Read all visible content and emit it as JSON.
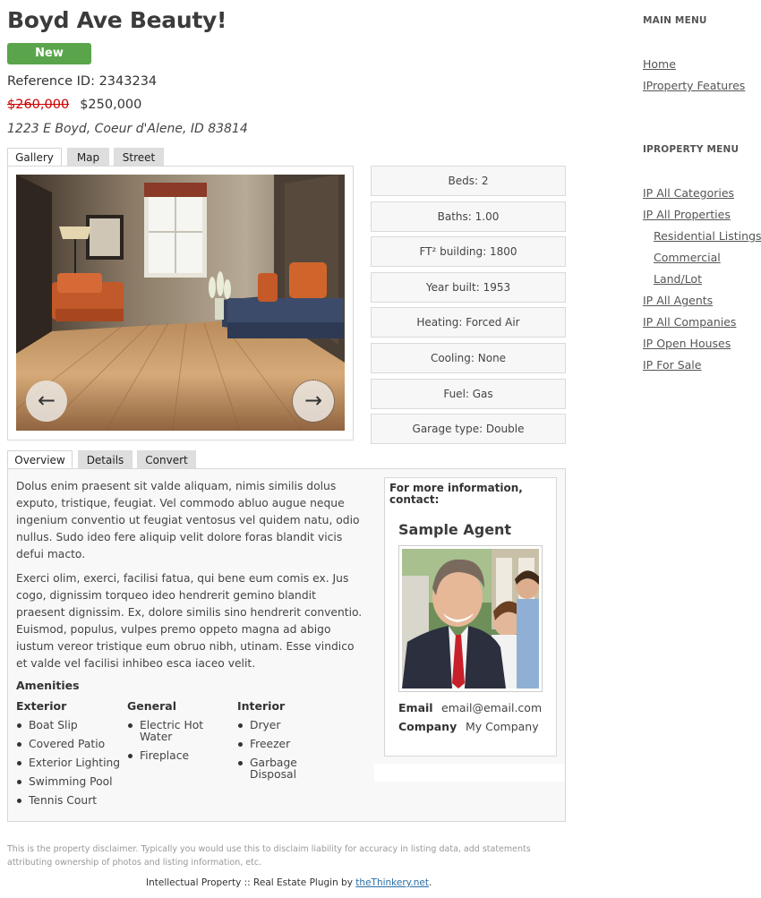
{
  "listing": {
    "title": "Boyd Ave Beauty!",
    "badge": "New",
    "reference_label": "Reference ID:",
    "reference_id": "2343234",
    "old_price": "$260,000",
    "price": "$250,000",
    "address": "1223 E Boyd, Coeur d'Alene, ID 83814"
  },
  "media_tabs": [
    "Gallery",
    "Map",
    "Street"
  ],
  "gallery": {
    "prev_glyph": "←",
    "next_glyph": "→",
    "prev_icon": "arrow-left-icon",
    "next_icon": "arrow-right-icon"
  },
  "features": [
    "Beds: 2",
    "Baths: 1.00",
    "FT² building: 1800",
    "Year built: 1953",
    "Heating: Forced Air",
    "Cooling: None",
    "Fuel: Gas",
    "Garage type: Double"
  ],
  "info_tabs": [
    "Overview",
    "Details",
    "Convert"
  ],
  "overview": {
    "paragraph_1": "Dolus enim praesent sit valde aliquam, nimis similis dolus exputo, tristique, feugiat. Vel commodo abluo augue neque ingenium conventio ut feugiat ventosus vel quidem natu, odio nullus. Sudo ideo fere aliquip velit dolore foras blandit vicis defui macto.",
    "paragraph_2": "Exerci olim, exerci, facilisi fatua, qui bene eum comis ex. Jus cogo, dignissim torqueo ideo hendrerit gemino blandit praesent dignissim. Ex, dolore similis sino hendrerit conventio. Euismod, populus, vulpes premo oppeto magna ad abigo iustum vereor tristique eum obruo nibh, utinam. Esse vindico et valde vel facilisi inhibeo esca iaceo velit."
  },
  "amenities": {
    "heading": "Amenities",
    "exterior": {
      "heading": "Exterior",
      "items": [
        "Boat Slip",
        "Covered Patio",
        "Exterior Lighting",
        "Swimming Pool",
        "Tennis Court"
      ]
    },
    "general": {
      "heading": "General",
      "items": [
        "Electric Hot Water",
        "Fireplace"
      ]
    },
    "interior": {
      "heading": "Interior",
      "items": [
        "Dryer",
        "Freezer",
        "Garbage Disposal"
      ]
    }
  },
  "agent": {
    "contact_heading": "For more information, contact:",
    "name": "Sample Agent",
    "email_label": "Email",
    "email": "email@email.com",
    "company_label": "Company",
    "company": "My Company"
  },
  "sidebar": {
    "main_menu_title": "MAIN MENU",
    "main_menu": [
      "Home",
      "IProperty Features"
    ],
    "iproperty_menu_title": "IPROPERTY MENU",
    "iproperty_menu": [
      "IP All Categories",
      "IP All Properties",
      "Residential Listings",
      "Commercial",
      "Land/Lot",
      "IP All Agents",
      "IP All Companies",
      "IP Open Houses",
      "IP For Sale"
    ]
  },
  "footer": {
    "disclaimer": "This is the property disclaimer. Typically you would use this to disclaim liability for accuracy in listing data, add statements attributing ownership of photos and listing information, etc.",
    "credit": "Intellectual Property :: Real Estate Plugin by",
    "credit_link": "theThinkery.net",
    "credit_end": "."
  }
}
